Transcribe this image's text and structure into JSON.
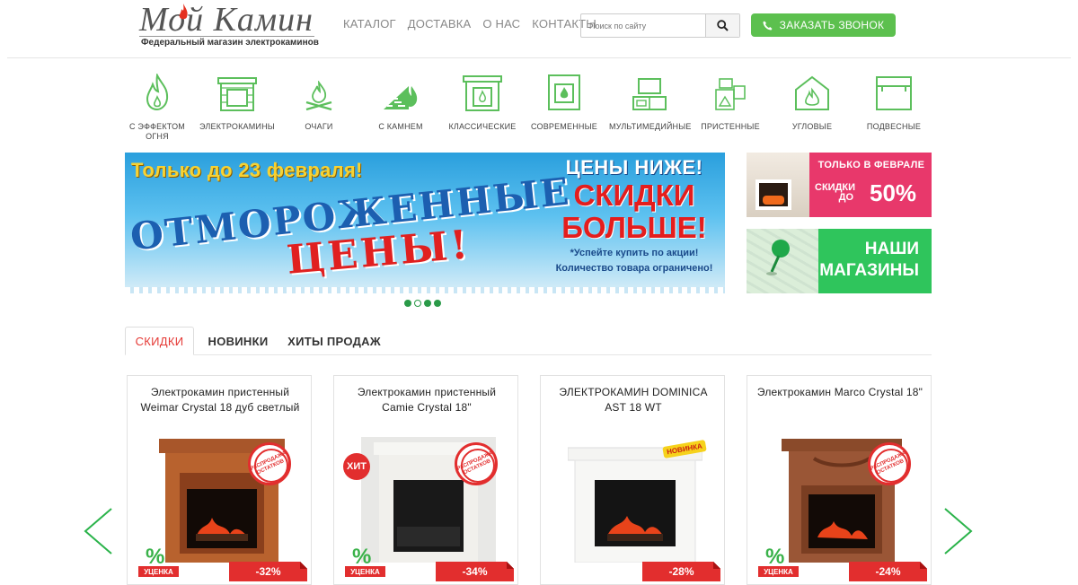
{
  "header": {
    "logo_title": "Мой Камин",
    "logo_subtitle": "Федеральный магазин электрокаминов",
    "nav": [
      "КАТАЛОГ",
      "ДОСТАВКА",
      "О НАС",
      "КОНТАКТЫ"
    ],
    "search_placeholder": "Поиск по сайту",
    "call_button": "ЗАКАЗАТЬ ЗВОНОК"
  },
  "categories": [
    {
      "label": "С ЭФФЕКТОМ ОГНЯ",
      "icon": "flame-icon"
    },
    {
      "label": "ЭЛЕКТРОКАМИНЫ",
      "icon": "electric-fireplace-icon"
    },
    {
      "label": "ОЧАГИ",
      "icon": "hearth-icon"
    },
    {
      "label": "С КАМНЕМ",
      "icon": "stone-fireplace-icon"
    },
    {
      "label": "КЛАССИЧЕСКИЕ",
      "icon": "classic-fireplace-icon"
    },
    {
      "label": "СОВРЕМЕННЫЕ",
      "icon": "modern-fireplace-icon"
    },
    {
      "label": "МУЛЬТИМЕДИЙНЫЕ",
      "icon": "multimedia-fireplace-icon"
    },
    {
      "label": "ПРИСТЕННЫЕ",
      "icon": "wall-fireplace-icon"
    },
    {
      "label": "УГЛОВЫЕ",
      "icon": "corner-fireplace-icon"
    },
    {
      "label": "ПОДВЕСНЫЕ",
      "icon": "hanging-fireplace-icon"
    }
  ],
  "banner": {
    "until": "Только до 23 февраля!",
    "word1": "ОТМОРОЖЕННЫЕ",
    "word2": "ЦЕНЫ!",
    "prices_lower": "ЦЕНЫ НИЖЕ!",
    "discounts": "СКИДКИ",
    "bigger": "БОЛЬШЕ!",
    "hurry1": "*Успейте купить по акции!",
    "hurry2": "Количество товара ограничено!"
  },
  "side_banners": {
    "promo_top": "ТОЛЬКО В ФЕВРАЛЕ",
    "promo_discount": "СКИДКИ",
    "promo_upto": "ДО",
    "promo_pct": "50%",
    "stores_line1": "НАШИ",
    "stores_line2": "МАГАЗИНЫ"
  },
  "tabs": [
    "СКИДКИ",
    "НОВИНКИ",
    "ХИТЫ ПРОДАЖ"
  ],
  "badges": {
    "markdown": "УЦЕНКА",
    "clearance": "РАСПРОДАЖА ОСТАТКОВ",
    "hit": "ХИТ",
    "new": "НОВИНКА"
  },
  "products": [
    {
      "title": "Электрокамин пристенный Weimar Crystal 18 дуб светлый",
      "discount": "-32%"
    },
    {
      "title": "Электрокамин пристенный Camie Crystal 18\"",
      "discount": "-34%"
    },
    {
      "title": "ЭЛЕКТРОКАМИН DOMINICA AST 18 WT",
      "discount": "-28%"
    },
    {
      "title": "Электрокамин Marco Crystal 18\"",
      "discount": "-24%"
    }
  ],
  "colors": {
    "accent_green": "#5cc04e",
    "sale_red": "#e22e2e",
    "icon_green": "#5cbf5c"
  }
}
